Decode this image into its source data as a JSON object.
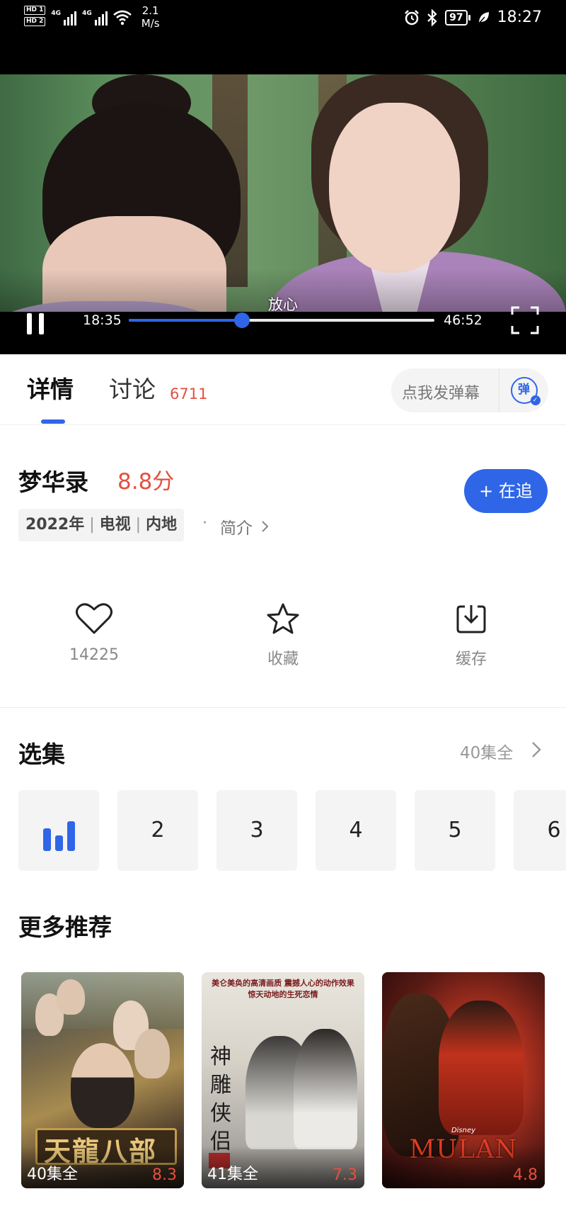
{
  "status_bar": {
    "sim1": "HD 1",
    "sim2": "HD 2",
    "net_type": "4G",
    "net_speed_value": "2.1",
    "net_speed_unit": "M/s",
    "battery": "97",
    "time": "18:27",
    "icons": [
      "alarm-icon",
      "bluetooth-icon",
      "battery-icon",
      "leaf-icon"
    ]
  },
  "player": {
    "subtitle": "放心",
    "current_time": "18:35",
    "total_time": "46:52",
    "progress": 0.37,
    "accent_color": "#2f66e8"
  },
  "tabs": {
    "detail": "详情",
    "discuss": "讨论",
    "discuss_count": "6711",
    "danmaku_placeholder": "点我发弹幕",
    "danmaku_icon_text": "弹"
  },
  "show": {
    "title": "梦华录",
    "score": "8.8分",
    "year": "2022年",
    "type": "电视",
    "region": "内地",
    "intro_label": "简介",
    "follow_label": "+ 在追"
  },
  "actions": {
    "like_count": "14225",
    "favorite_label": "收藏",
    "cache_label": "缓存"
  },
  "episodes": {
    "title": "选集",
    "total_label": "40集全",
    "items": [
      "1",
      "2",
      "3",
      "4",
      "5",
      "6"
    ],
    "playing_index": 0
  },
  "recommendations": {
    "title": "更多推荐",
    "items": [
      {
        "poster_title": "天龍八部",
        "episodes": "40集全",
        "score": "8.3"
      },
      {
        "poster_header": "美仑美奂的高清画质 震撼人心的动作效果 惊天动地的生死恋情",
        "poster_title": "神雕侠侣",
        "episodes": "41集全",
        "score": "7.3"
      },
      {
        "poster_brand": "Disney",
        "poster_title": "MULAN",
        "episodes": "",
        "score": "4.8"
      }
    ]
  }
}
